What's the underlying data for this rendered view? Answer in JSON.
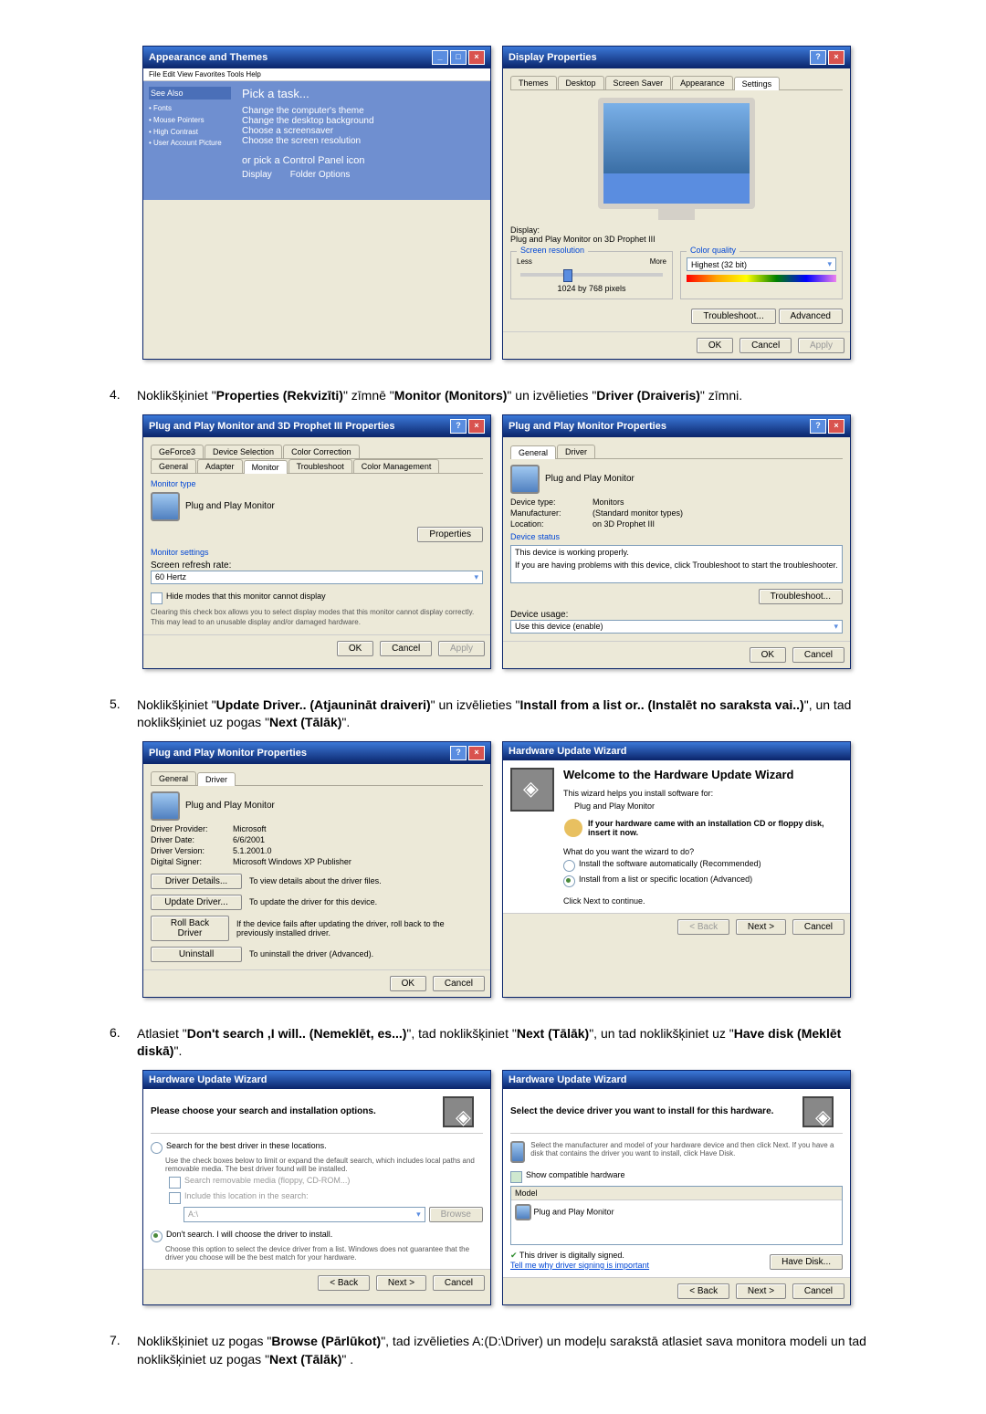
{
  "steps": {
    "s4": {
      "num": "4.",
      "text_pre": "Noklikšķiniet \"",
      "bold1": "Properties (Rekvizīti)",
      "mid1": "\" zīmnē \"",
      "bold2": "Monitor (Monitors)",
      "mid2": "\" un izvēlieties \"",
      "bold3": "Driver (Draiveris)",
      "end": "\" zīmni."
    },
    "s5": {
      "num": "5.",
      "text_pre": "Noklikšķiniet \"",
      "bold1": "Update Driver.. (Atjaunināt draiveri)",
      "mid1": "\" un izvēlieties \"",
      "bold2": "Install from a list or.. (Instalēt no saraksta vai..)",
      "mid2": "\", un tad noklikšķiniet uz pogas \"",
      "bold3": "Next (Tālāk)",
      "end": "\"."
    },
    "s6": {
      "num": "6.",
      "text_pre": "Atlasiet \"",
      "bold1": "Don't search ,I will.. (Nemeklēt, es...)",
      "mid1": "\", tad noklikšķiniet \"",
      "bold2": "Next (Tālāk)",
      "mid2": "\", un tad noklikšķiniet uz \"",
      "bold3": "Have disk (Meklēt diskā)",
      "end": "\"."
    },
    "s7": {
      "num": "7.",
      "text_pre": "Noklikšķiniet uz pogas \"",
      "bold1": "Browse (Pārlūkot)",
      "mid1": "\", tad izvēlieties A:(D:\\Driver) un modeļu sarakstā atlasiet sava monitora modeli un tad noklikšķiniet uz pogas \"",
      "bold2": "Next (Tālāk)",
      "end": "\" ."
    }
  },
  "fig1a": {
    "title": "Appearance and Themes",
    "sidebar_heading": "See Also",
    "task_heading": "Pick a task...",
    "task1": "Change the computer's theme",
    "task2": "Change the desktop background",
    "task3": "Choose a screensaver",
    "task4": "Choose the screen resolution",
    "cp_heading": "or pick a Control Panel icon",
    "cp1": "Display",
    "cp2": "Folder Options"
  },
  "fig1b": {
    "title": "Display Properties",
    "tabs": [
      "Themes",
      "Desktop",
      "Screen Saver",
      "Appearance",
      "Settings"
    ],
    "display_label": "Display:",
    "display_value": "Plug and Play Monitor on 3D Prophet III",
    "res_label": "Screen resolution",
    "less": "Less",
    "more": "More",
    "res_value": "1024 by 768 pixels",
    "cq_label": "Color quality",
    "cq_value": "Highest (32 bit)",
    "troubleshoot": "Troubleshoot...",
    "advanced": "Advanced",
    "ok": "OK",
    "cancel": "Cancel",
    "apply": "Apply"
  },
  "fig2a": {
    "title": "Plug and Play Monitor and 3D Prophet III Properties",
    "tabs_row1": [
      "GeForce3",
      "Device Selection",
      "Color Correction"
    ],
    "tabs_row2": [
      "General",
      "Adapter",
      "Monitor",
      "Troubleshoot",
      "Color Management"
    ],
    "monitor_type": "Monitor type",
    "monitor_name": "Plug and Play Monitor",
    "properties": "Properties",
    "monitor_settings": "Monitor settings",
    "refresh_label": "Screen refresh rate:",
    "refresh_value": "60 Hertz",
    "hide_modes": "Hide modes that this monitor cannot display",
    "hide_desc": "Clearing this check box allows you to select display modes that this monitor cannot display correctly. This may lead to an unusable display and/or damaged hardware.",
    "ok": "OK",
    "cancel": "Cancel",
    "apply": "Apply"
  },
  "fig2b": {
    "title": "Plug and Play Monitor Properties",
    "tabs": [
      "General",
      "Driver"
    ],
    "name": "Plug and Play Monitor",
    "dtype_l": "Device type:",
    "dtype_v": "Monitors",
    "manu_l": "Manufacturer:",
    "manu_v": "(Standard monitor types)",
    "loc_l": "Location:",
    "loc_v": "on 3D Prophet III",
    "status_label": "Device status",
    "status_text": "This device is working properly.",
    "status_help": "If you are having problems with this device, click Troubleshoot to start the troubleshooter.",
    "troubleshoot": "Troubleshoot...",
    "usage_label": "Device usage:",
    "usage_value": "Use this device (enable)",
    "ok": "OK",
    "cancel": "Cancel"
  },
  "fig3a": {
    "title": "Plug and Play Monitor Properties",
    "tabs": [
      "General",
      "Driver"
    ],
    "name": "Plug and Play Monitor",
    "prov_l": "Driver Provider:",
    "prov_v": "Microsoft",
    "date_l": "Driver Date:",
    "date_v": "6/6/2001",
    "ver_l": "Driver Version:",
    "ver_v": "5.1.2001.0",
    "sign_l": "Digital Signer:",
    "sign_v": "Microsoft Windows XP Publisher",
    "details_btn": "Driver Details...",
    "details_desc": "To view details about the driver files.",
    "update_btn": "Update Driver...",
    "update_desc": "To update the driver for this device.",
    "rollback_btn": "Roll Back Driver",
    "rollback_desc": "If the device fails after updating the driver, roll back to the previously installed driver.",
    "uninstall_btn": "Uninstall",
    "uninstall_desc": "To uninstall the driver (Advanced).",
    "ok": "OK",
    "cancel": "Cancel"
  },
  "fig3b": {
    "title": "Hardware Update Wizard",
    "welcome": "Welcome to the Hardware Update Wizard",
    "help1": "This wizard helps you install software for:",
    "device": "Plug and Play Monitor",
    "cd_hint": "If your hardware came with an installation CD or floppy disk, insert it now.",
    "question": "What do you want the wizard to do?",
    "opt1": "Install the software automatically (Recommended)",
    "opt2": "Install from a list or specific location (Advanced)",
    "continue": "Click Next to continue.",
    "back": "< Back",
    "next": "Next >",
    "cancel": "Cancel"
  },
  "fig4a": {
    "title": "Hardware Update Wizard",
    "heading": "Please choose your search and installation options.",
    "opt1": "Search for the best driver in these locations.",
    "opt1_desc": "Use the check boxes below to limit or expand the default search, which includes local paths and removable media. The best driver found will be installed.",
    "cb1": "Search removable media (floppy, CD-ROM...)",
    "cb2": "Include this location in the search:",
    "path": "A:\\",
    "browse": "Browse",
    "opt2": "Don't search. I will choose the driver to install.",
    "opt2_desc": "Choose this option to select the device driver from a list. Windows does not guarantee that the driver you choose will be the best match for your hardware.",
    "back": "< Back",
    "next": "Next >",
    "cancel": "Cancel"
  },
  "fig4b": {
    "title": "Hardware Update Wizard",
    "heading": "Select the device driver you want to install for this hardware.",
    "instr": "Select the manufacturer and model of your hardware device and then click Next. If you have a disk that contains the driver you want to install, click Have Disk.",
    "compat": "Show compatible hardware",
    "model_label": "Model",
    "model_item": "Plug and Play Monitor",
    "signed": "This driver is digitally signed.",
    "tell_me": "Tell me why driver signing is important",
    "have_disk": "Have Disk...",
    "back": "< Back",
    "next": "Next >",
    "cancel": "Cancel"
  }
}
